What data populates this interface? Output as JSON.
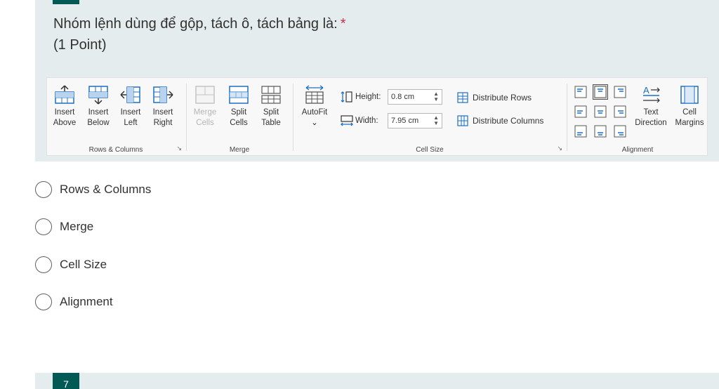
{
  "question": {
    "title": "Nhóm lệnh dùng để gộp, tách ô, tách bảng là:",
    "required_marker": "*",
    "points": "(1 Point)"
  },
  "ribbon": {
    "groups": [
      {
        "label": "Rows & Columns",
        "buttons": [
          {
            "line1": "Insert",
            "line2": "Above",
            "icon": "insert-above-icon"
          },
          {
            "line1": "Insert",
            "line2": "Below",
            "icon": "insert-below-icon"
          },
          {
            "line1": "Insert",
            "line2": "Left",
            "icon": "insert-left-icon"
          },
          {
            "line1": "Insert",
            "line2": "Right",
            "icon": "insert-right-icon"
          }
        ]
      },
      {
        "label": "Merge",
        "buttons": [
          {
            "line1": "Merge",
            "line2": "Cells",
            "icon": "merge-cells-icon",
            "disabled": true
          },
          {
            "line1": "Split",
            "line2": "Cells",
            "icon": "split-cells-icon"
          },
          {
            "line1": "Split",
            "line2": "Table",
            "icon": "split-table-icon"
          }
        ]
      },
      {
        "label": "Cell Size",
        "autofit": {
          "label": "AutoFit",
          "chevron": "⌄",
          "icon": "autofit-icon"
        },
        "height": {
          "label": "Height:",
          "value": "0.8 cm",
          "icon": "row-height-icon"
        },
        "width": {
          "label": "Width:",
          "value": "7.95 cm",
          "icon": "column-width-icon"
        },
        "distribute_rows": {
          "label": "Distribute Rows",
          "icon": "distribute-rows-icon"
        },
        "distribute_columns": {
          "label": "Distribute Columns",
          "icon": "distribute-columns-icon"
        }
      },
      {
        "label": "Alignment",
        "text_direction": {
          "line1": "Text",
          "line2": "Direction",
          "icon": "text-direction-icon"
        },
        "cell_margins": {
          "line1": "Cell",
          "line2": "Margins",
          "icon": "cell-margins-icon"
        }
      }
    ],
    "launcher_glyph": "↘"
  },
  "options": [
    {
      "label": "Rows & Columns"
    },
    {
      "label": "Merge"
    },
    {
      "label": "Cell Size"
    },
    {
      "label": "Alignment"
    }
  ],
  "next_question": {
    "number": "7"
  },
  "colors": {
    "card_bg": "#e4eced",
    "accent": "#035a54",
    "required": "#c4314b",
    "ribbon_icon_blue": "#1e6fc4"
  }
}
